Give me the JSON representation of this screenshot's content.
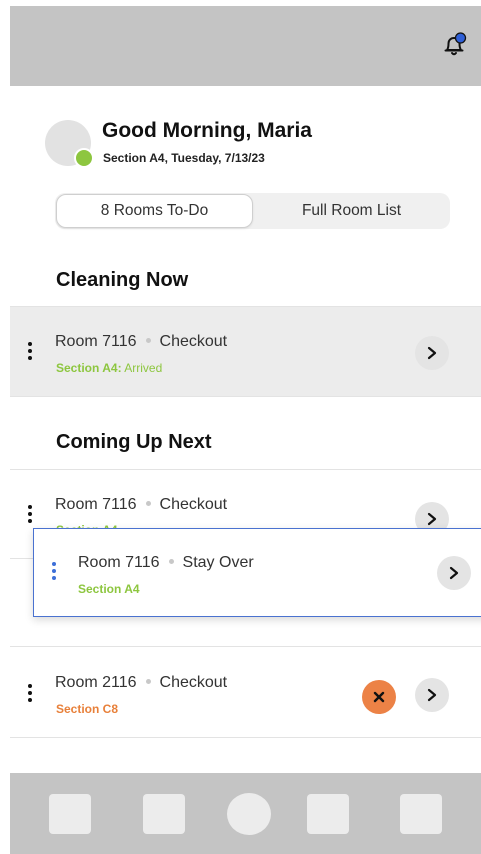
{
  "header": {
    "greeting": "Good Morning, Maria",
    "subtitle": "Section A4, Tuesday, 7/13/23",
    "icons": [
      "bell-icon",
      "notification-dot"
    ]
  },
  "tabs": {
    "active_label": "8 Rooms To-Do",
    "inactive_label": "Full Room List"
  },
  "cleaning_now": {
    "title": "Cleaning Now",
    "item": {
      "room": "Room 7116",
      "type": "Checkout",
      "section_label": "Section A4:",
      "section_status": "Arrived"
    }
  },
  "coming_up": {
    "title": "Coming Up Next",
    "items": [
      {
        "room": "Room 7116",
        "type": "Checkout",
        "section": "Section A4"
      },
      {
        "room": "Room 2116",
        "type": "Checkout",
        "section": "Section C8"
      }
    ]
  },
  "dragging_card": {
    "room": "Room 7116",
    "type": "Stay Over",
    "section": "Section A4"
  },
  "colors": {
    "accent_blue": "#4a72d0",
    "green": "#8dc63f",
    "orange": "#e8803a",
    "bar_grey": "#c4c4c4"
  }
}
